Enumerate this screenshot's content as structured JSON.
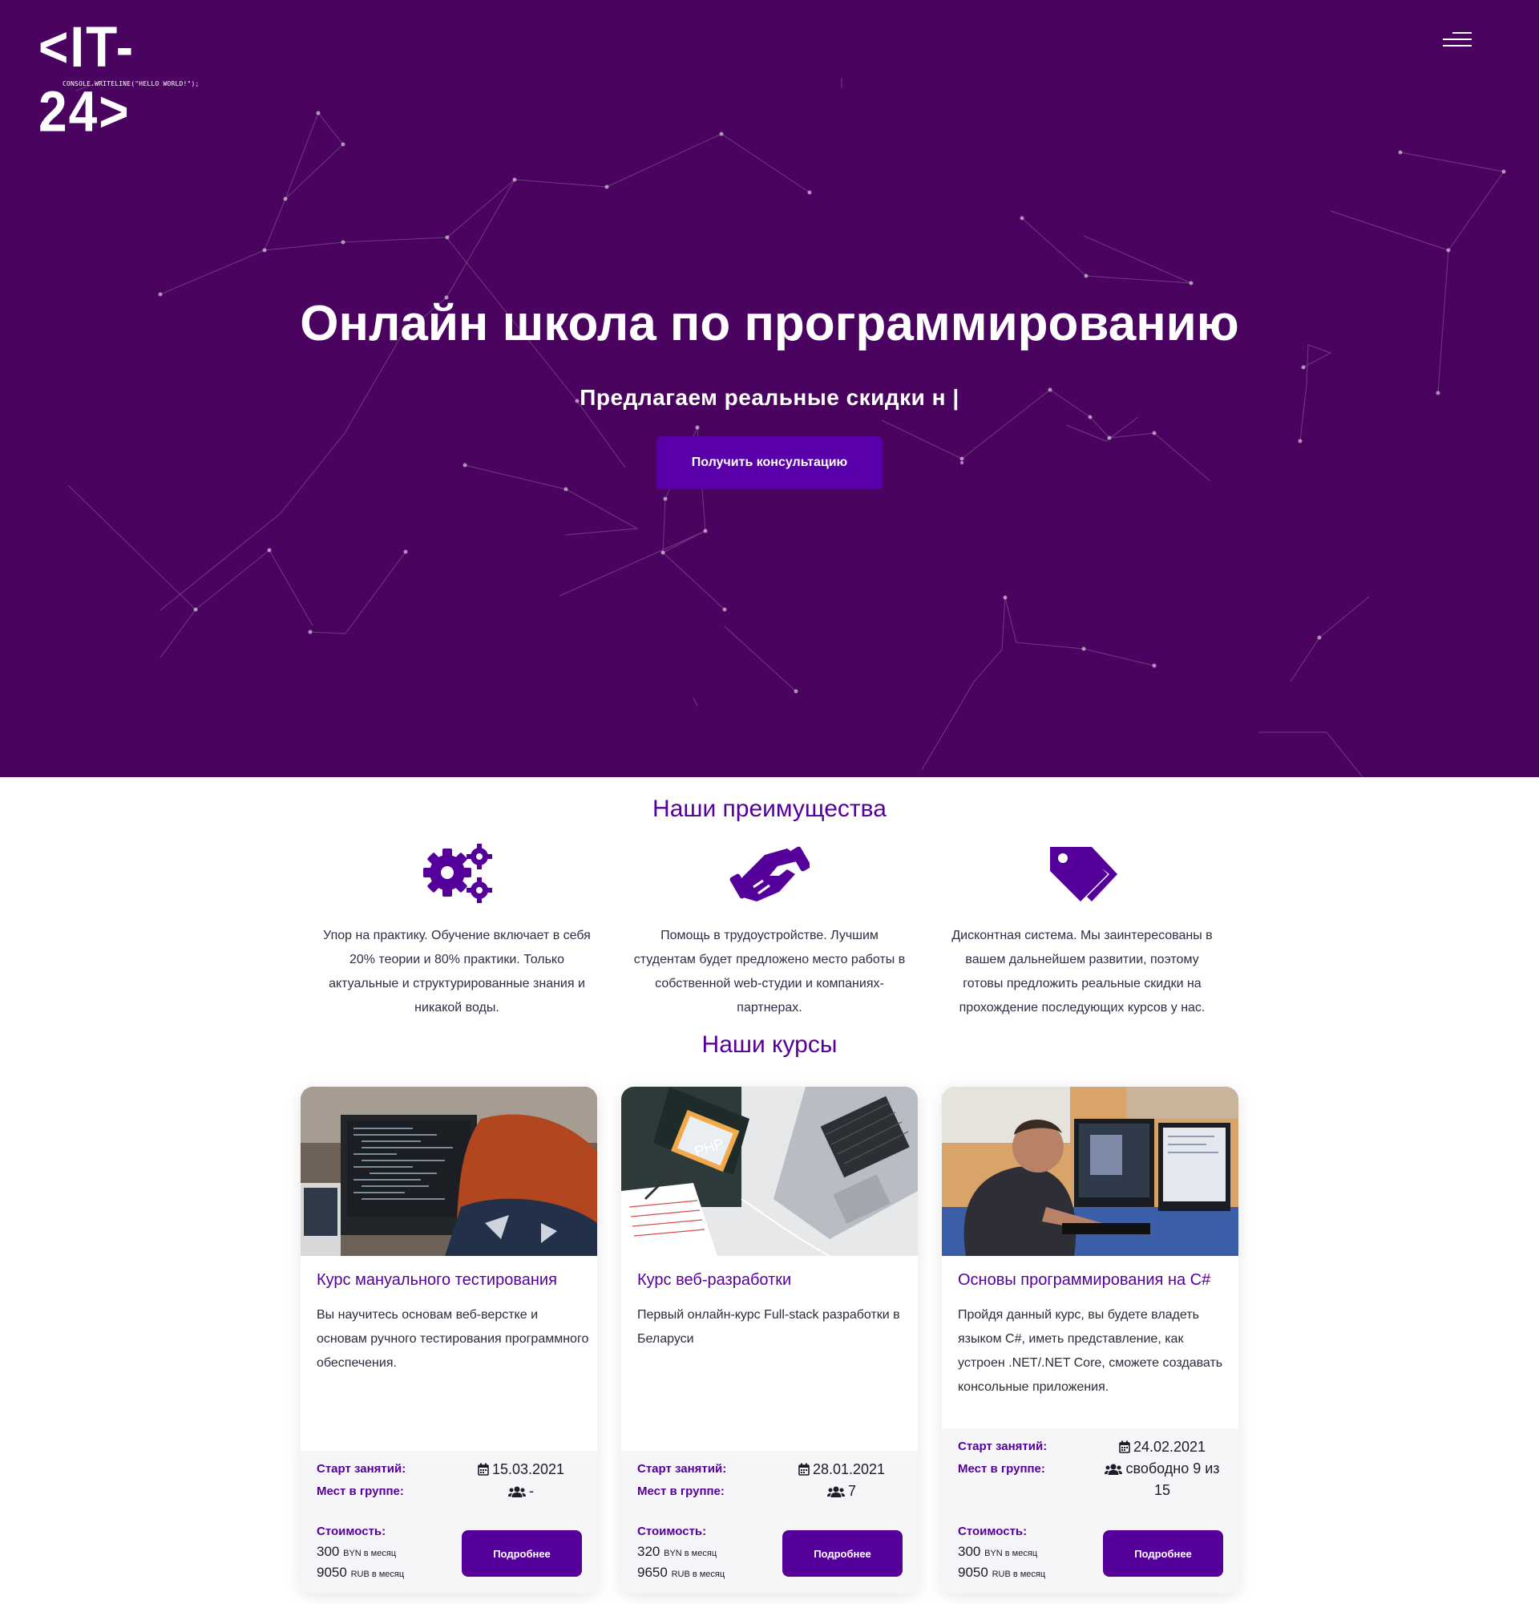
{
  "header": {
    "logo_text": "<IT-24>",
    "logo_tagline": "CONSOLE.WRITELINE(\"HELLO WORLD!\");",
    "menu_icon": "hamburger-menu-icon"
  },
  "hero": {
    "title": "Онлайн школа по программированию",
    "subtitle": "Предлагаем реальные скидки н |",
    "cta_label": "Получить консультацию",
    "background_color": "#4a045f",
    "accent_color": "#5a00ab"
  },
  "advantages": {
    "title": "Наши преимущества",
    "items": [
      {
        "icon": "gears-icon",
        "text": "Упор на практику. Обучение включает в себя 20% теории и 80% практики. Только актуальные и структурированные знания и никакой воды."
      },
      {
        "icon": "handshake-icon",
        "text": "Помощь в трудоустройстве. Лучшим студентам будет предложено место работы в собственной web-студии и компаниях-партнерах."
      },
      {
        "icon": "tags-icon",
        "text": "Дисконтная система. Мы заинтересованы в вашем дальнейшем развитии, поэтому готовы предложить реальные скидки на прохождение последующих курсов у нас."
      }
    ]
  },
  "courses": {
    "title": "Наши курсы",
    "start_label": "Старт занятий:",
    "seats_label": "Мест в группе:",
    "price_label": "Стоимость:",
    "more_label": "Подробнее",
    "items": [
      {
        "title": "Курс мануального тестирования",
        "description": "Вы научитесь основам веб-верстке и основам ручного тестирования программного обеспечения.",
        "start": "15.03.2021",
        "seats": "-",
        "price_byn": "300",
        "byn_unit": "BYN в месяц",
        "price_rub": "9050",
        "rub_unit": "RUB в месяц",
        "image": "woman-at-code-monitor"
      },
      {
        "title": "Курс веб-разработки",
        "description": "Первый онлайн-курс Full-stack разработки в Беларуси",
        "start": "28.01.2021",
        "seats": "7",
        "price_byn": "320",
        "byn_unit": "BYN в месяц",
        "price_rub": "9650",
        "rub_unit": "RUB в месяц",
        "image": "laptop-and-php-book"
      },
      {
        "title": "Основы программирования на C#",
        "description": "Пройдя данный курс, вы будете владеть языком C#, иметь представление, как устроен .NET/.NET Core, сможете создавать консольные приложения.",
        "start": "24.02.2021",
        "seats": "свободно 9 из 15",
        "price_byn": "300",
        "byn_unit": "BYN в месяц",
        "price_rub": "9050",
        "rub_unit": "RUB в месяц",
        "image": "man-at-two-monitors"
      }
    ]
  }
}
